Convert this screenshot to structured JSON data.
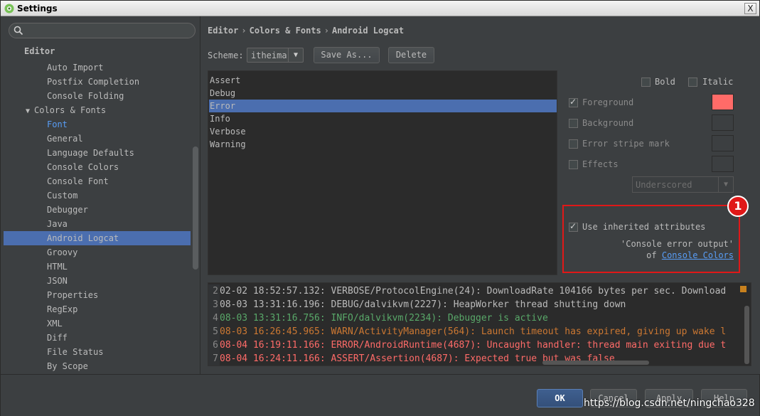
{
  "window": {
    "title": "Settings",
    "close_glyph": "X"
  },
  "search": {
    "placeholder": ""
  },
  "tree": {
    "items": [
      {
        "label": "Editor",
        "kind": "head"
      },
      {
        "label": "Auto Import"
      },
      {
        "label": "Postfix Completion"
      },
      {
        "label": "Console Folding"
      },
      {
        "label": "Colors & Fonts",
        "kind": "group"
      },
      {
        "label": "Font",
        "kind": "link"
      },
      {
        "label": "General"
      },
      {
        "label": "Language Defaults"
      },
      {
        "label": "Console Colors"
      },
      {
        "label": "Console Font"
      },
      {
        "label": "Custom"
      },
      {
        "label": "Debugger"
      },
      {
        "label": "Java"
      },
      {
        "label": "Android Logcat",
        "kind": "selected"
      },
      {
        "label": "Groovy"
      },
      {
        "label": "HTML"
      },
      {
        "label": "JSON"
      },
      {
        "label": "Properties"
      },
      {
        "label": "RegExp"
      },
      {
        "label": "XML"
      },
      {
        "label": "Diff"
      },
      {
        "label": "File Status"
      },
      {
        "label": "By Scope"
      }
    ],
    "expand_glyph": "▼"
  },
  "breadcrumb": {
    "parts": [
      "Editor",
      "Colors & Fonts",
      "Android Logcat"
    ],
    "sep": "›"
  },
  "scheme": {
    "label": "Scheme:",
    "value": "itheima",
    "dropdown_glyph": "▼"
  },
  "buttons": {
    "save_as": "Save As...",
    "delete": "Delete"
  },
  "tokens": {
    "items": [
      "Assert",
      "Debug",
      "Error",
      "Info",
      "Verbose",
      "Warning"
    ],
    "selected": "Error"
  },
  "attributes": {
    "bold": "Bold",
    "italic": "Italic",
    "foreground": "Foreground",
    "background": "Background",
    "error_stripe": "Error stripe mark",
    "effects": "Effects",
    "effects_type": "Underscored",
    "foreground_color": "#ff6b68",
    "use_inherited": "Use inherited attributes",
    "inherited_from": "'Console error output'",
    "of_label": "of",
    "inherited_link": "Console Colors"
  },
  "badge": {
    "number": "1"
  },
  "preview": {
    "lines": [
      {
        "num": "2",
        "text": "02-02 18:52:57.132: VERBOSE/ProtocolEngine(24): DownloadRate 104166 bytes per sec. Download",
        "color": "#bbbbbb"
      },
      {
        "num": "3",
        "text": "08-03 13:31:16.196: DEBUG/dalvikvm(2227): HeapWorker thread shutting down",
        "color": "#bbbbbb"
      },
      {
        "num": "4",
        "text": "08-03 13:31:16.756: INFO/dalvikvm(2234): Debugger is active",
        "color": "#59a869"
      },
      {
        "num": "5",
        "text": "08-03 16:26:45.965: WARN/ActivityManager(564): Launch timeout has expired, giving up wake l",
        "color": "#cc7832"
      },
      {
        "num": "6",
        "text": "08-04 16:19:11.166: ERROR/AndroidRuntime(4687): Uncaught handler: thread main exiting due t",
        "color": "#ff6b68"
      },
      {
        "num": "7",
        "text": "08-04 16:24:11.166: ASSERT/Assertion(4687): Expected true but was false",
        "color": "#ff6b68"
      }
    ]
  },
  "footer": {
    "ok": "OK",
    "cancel": "Cancel",
    "apply": "Apply",
    "help": "Help"
  },
  "watermark": {
    "text": "https://blog.csdn.net/ningchao328"
  }
}
